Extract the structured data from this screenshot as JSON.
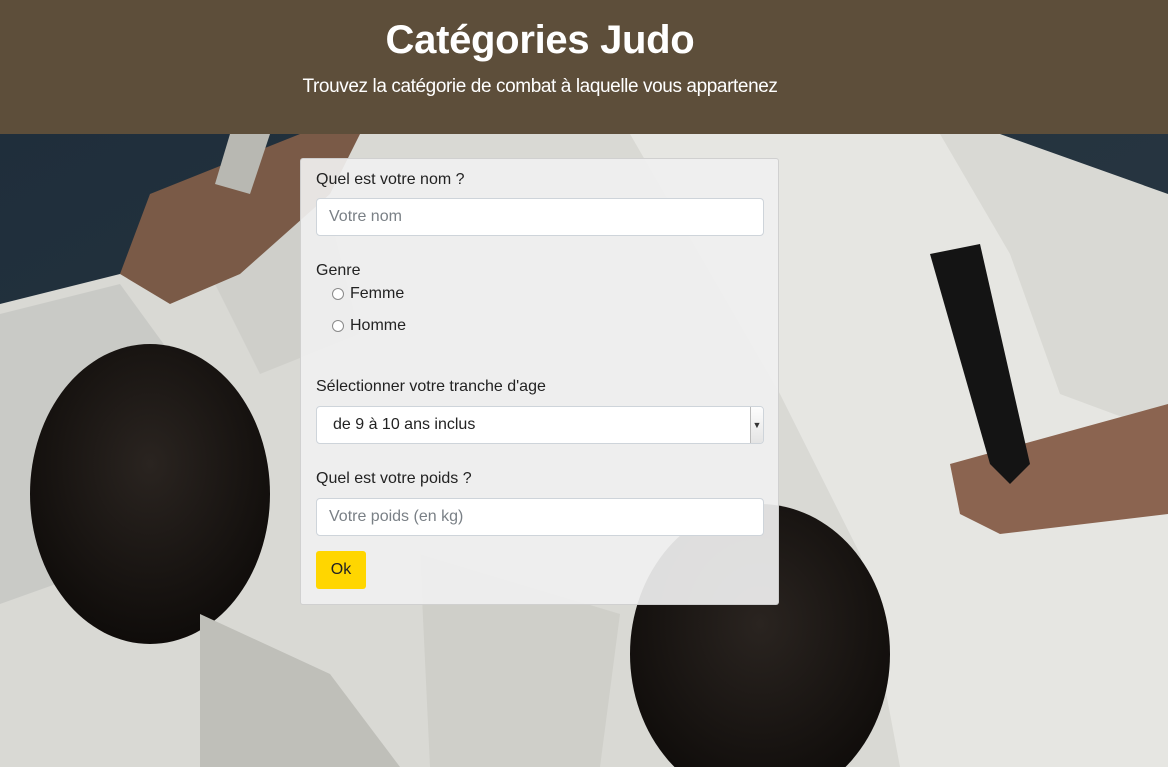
{
  "header": {
    "title": "Catégories Judo",
    "subtitle": "Trouvez la catégorie de combat à laquelle vous appartenez"
  },
  "form": {
    "name_label": "Quel est votre nom ?",
    "name_placeholder": "Votre nom",
    "gender_label": "Genre",
    "gender_options": [
      "Femme",
      "Homme"
    ],
    "age_label": "Sélectionner votre tranche d'age",
    "age_selected": "de 9 à 10 ans inclus",
    "weight_label": "Quel est votre poids ?",
    "weight_placeholder": "Votre poids (en kg)",
    "submit_label": "Ok"
  },
  "colors": {
    "header_bg": "#5d4e3a",
    "button_bg": "#ffd600"
  },
  "icons": {
    "select_arrow": "chevron-down-icon"
  }
}
